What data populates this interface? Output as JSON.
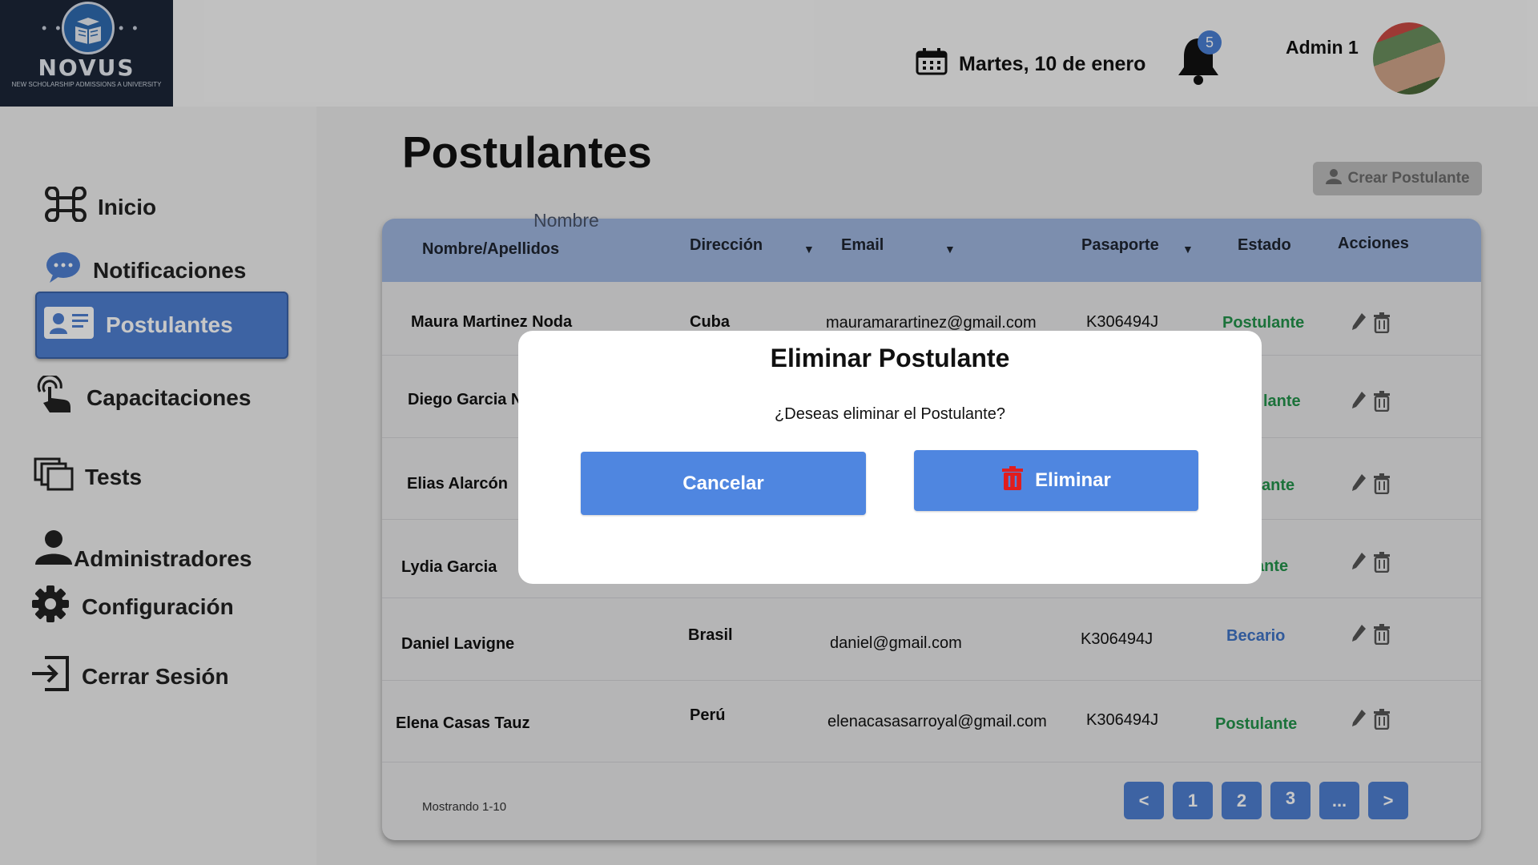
{
  "header": {
    "logo": {
      "word": "NOVUS",
      "subtitle": "NEW SCHOLARSHIP ADMISSIONS A UNIVERSITY"
    },
    "date": "Martes, 10 de enero",
    "notifications_count": "5",
    "admin_name": "Admin 1"
  },
  "sidebar": {
    "items": [
      {
        "label": "Inicio",
        "icon": "command-icon"
      },
      {
        "label": "Notificaciones",
        "icon": "chat-bubble-icon"
      },
      {
        "label": "Postulantes",
        "icon": "id-card-icon",
        "active": true
      },
      {
        "label": "Capacitaciones",
        "icon": "touch-icon"
      },
      {
        "label": "Tests",
        "icon": "copy-icon"
      },
      {
        "label": "Administradores",
        "icon": "person-icon"
      },
      {
        "label": "Configuración",
        "icon": "gear-icon"
      },
      {
        "label": "Cerrar Sesión",
        "icon": "logout-icon"
      }
    ]
  },
  "main": {
    "title": "Postulantes",
    "create_button": "Crear Postulante",
    "floating_label": "Nombre",
    "columns": [
      "Nombre/Apellidos",
      "Dirección",
      "Email",
      "Pasaporte",
      "Estado",
      "Acciones"
    ],
    "rows": [
      {
        "name": "Maura Martinez Noda",
        "country": "Cuba",
        "email": "mauramarartinez@gmail.com",
        "passport": "K306494J",
        "state": "Postulante"
      },
      {
        "name": "Diego Garcia Ni",
        "country": "",
        "email": "",
        "passport": "",
        "state": "lante"
      },
      {
        "name": "Elias Alarcón",
        "country": "",
        "email": "",
        "passport": "",
        "state": "ante"
      },
      {
        "name": "Lydia Garcia",
        "country": "",
        "email": "",
        "passport": "",
        "state": "ante"
      },
      {
        "name": "Daniel Lavigne",
        "country": "Brasil",
        "email": "daniel@gmail.com",
        "passport": "K306494J",
        "state": "Becario"
      },
      {
        "name": "Elena Casas Tauz",
        "country": "Perú",
        "email": "elenacasasarroyal@gmail.com",
        "passport": "K306494J",
        "state": "Postulante"
      }
    ],
    "footer_text": "Mostrando 1-10",
    "pagination": [
      "<",
      "1",
      "2",
      "3",
      "...",
      ">"
    ]
  },
  "modal": {
    "title": "Eliminar Postulante",
    "message": "¿Deseas eliminar el Postulante?",
    "cancel_label": "Cancelar",
    "delete_label": "Eliminar"
  },
  "colors": {
    "accent": "#4f7fd1",
    "postulante": "#23924b",
    "becario": "#3f74c6",
    "delete_icon": "#e11d1d"
  }
}
